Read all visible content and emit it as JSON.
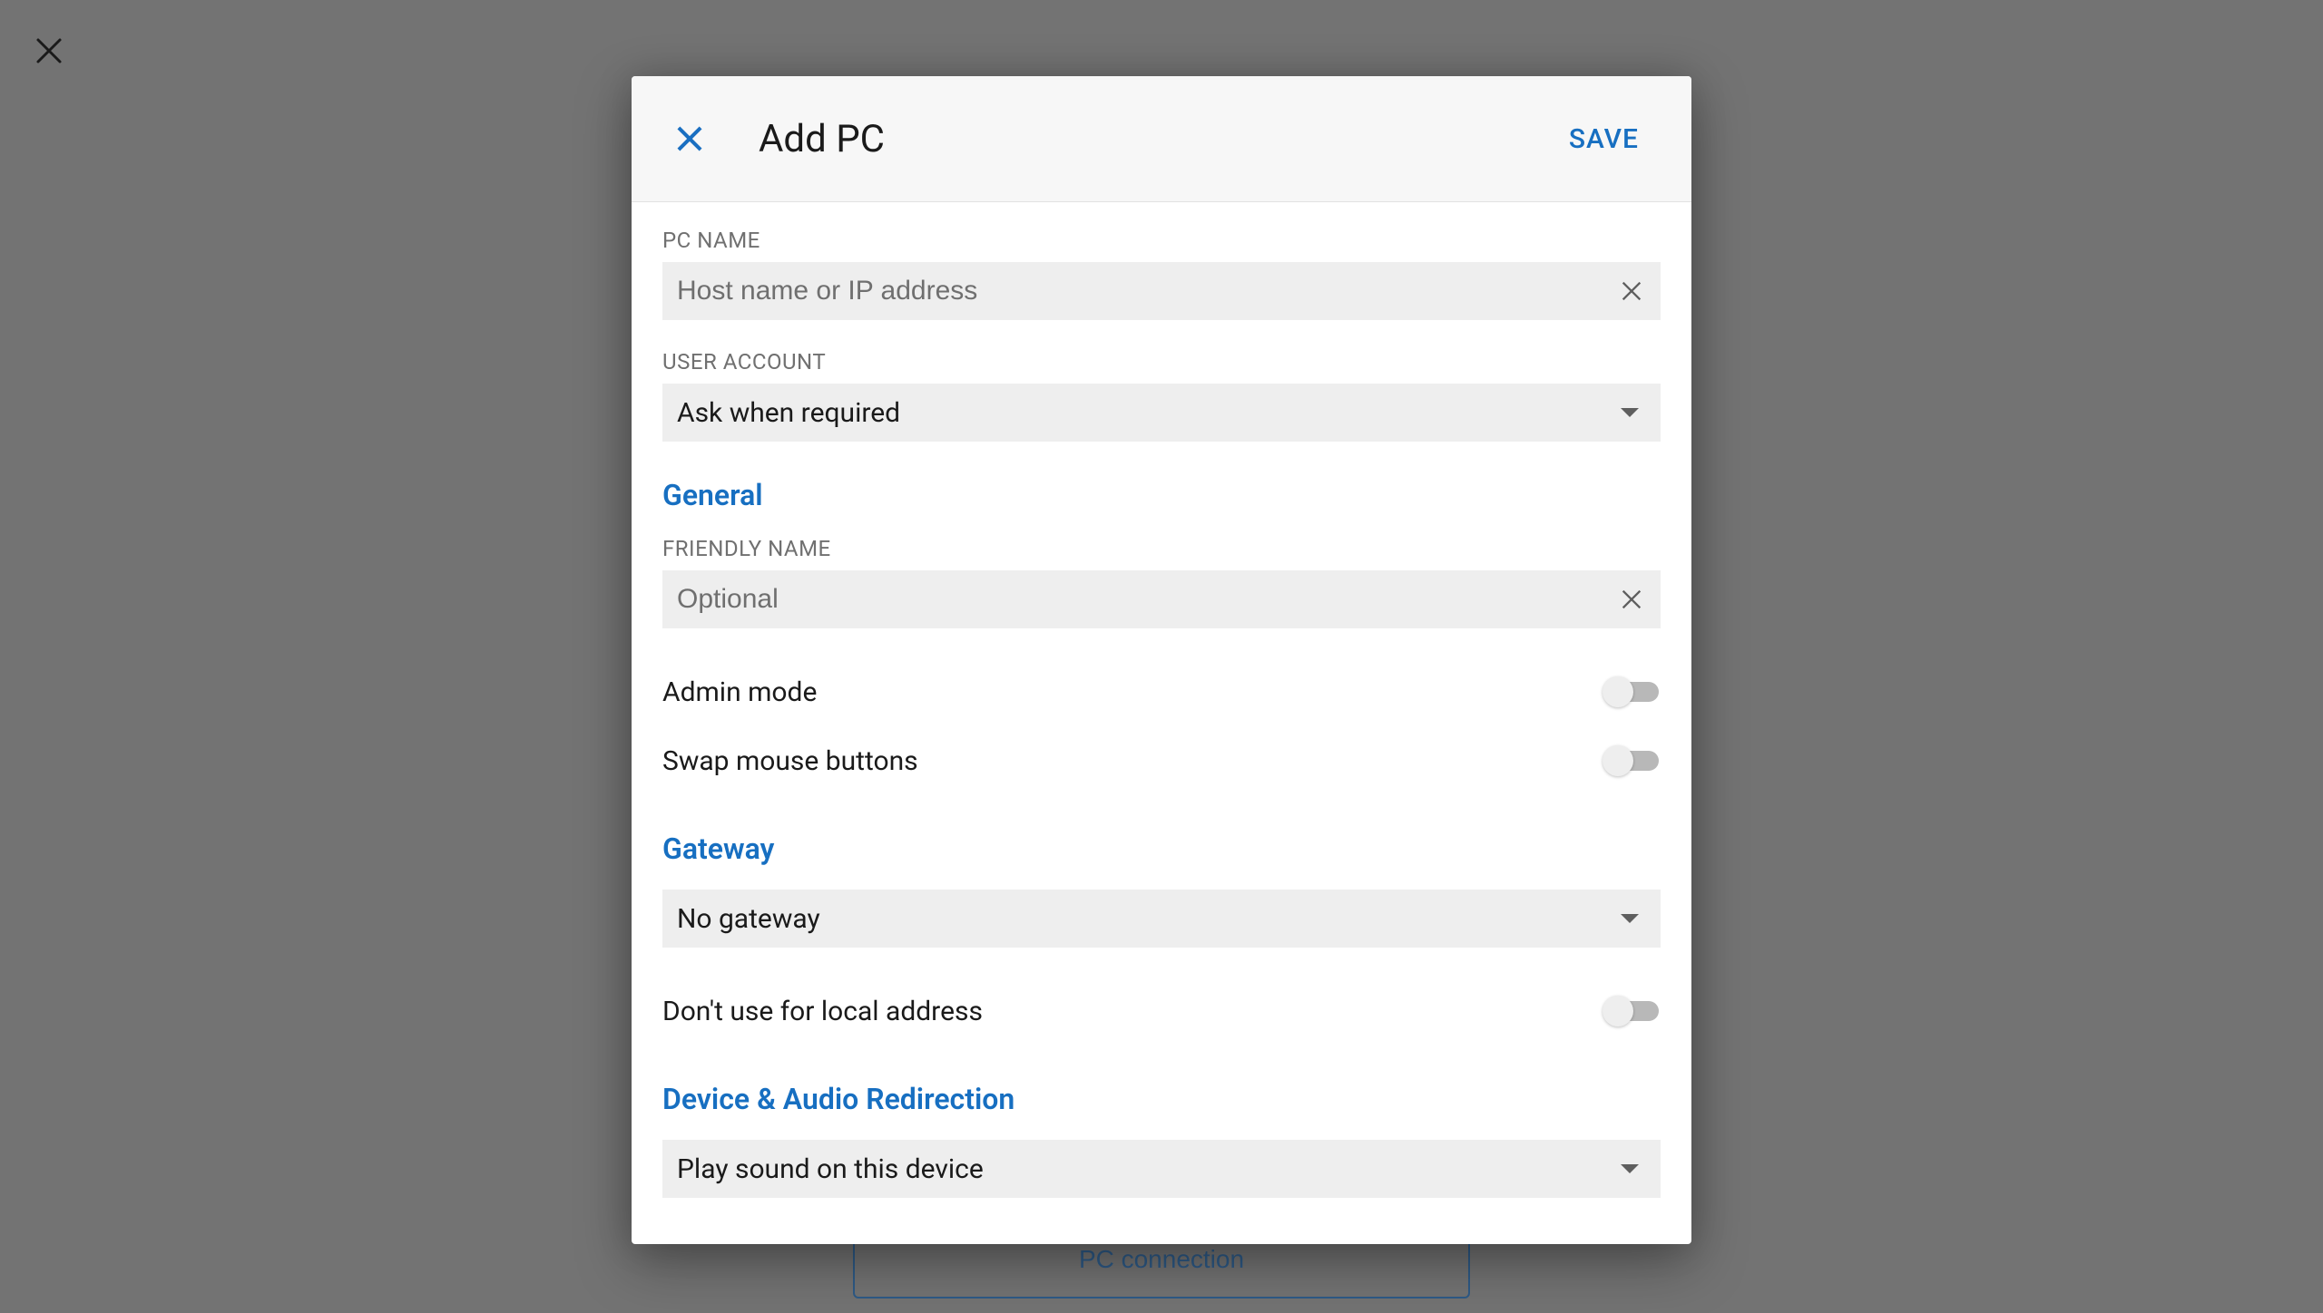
{
  "page": {
    "pc_connection_label": "PC connection"
  },
  "modal": {
    "title": "Add PC",
    "save_label": "SAVE",
    "pc_name": {
      "label": "PC NAME",
      "placeholder": "Host name or IP address",
      "value": ""
    },
    "user_account": {
      "label": "USER ACCOUNT",
      "selected": "Ask when required"
    },
    "sections": {
      "general": {
        "title": "General",
        "friendly_name": {
          "label": "FRIENDLY NAME",
          "placeholder": "Optional",
          "value": ""
        },
        "admin_mode": {
          "label": "Admin mode",
          "on": false
        },
        "swap_mouse": {
          "label": "Swap mouse buttons",
          "on": false
        }
      },
      "gateway": {
        "title": "Gateway",
        "selected": "No gateway",
        "dont_use_local": {
          "label": "Don't use for local address",
          "on": false
        }
      },
      "audio": {
        "title": "Device & Audio Redirection",
        "selected": "Play sound on this device"
      }
    }
  }
}
